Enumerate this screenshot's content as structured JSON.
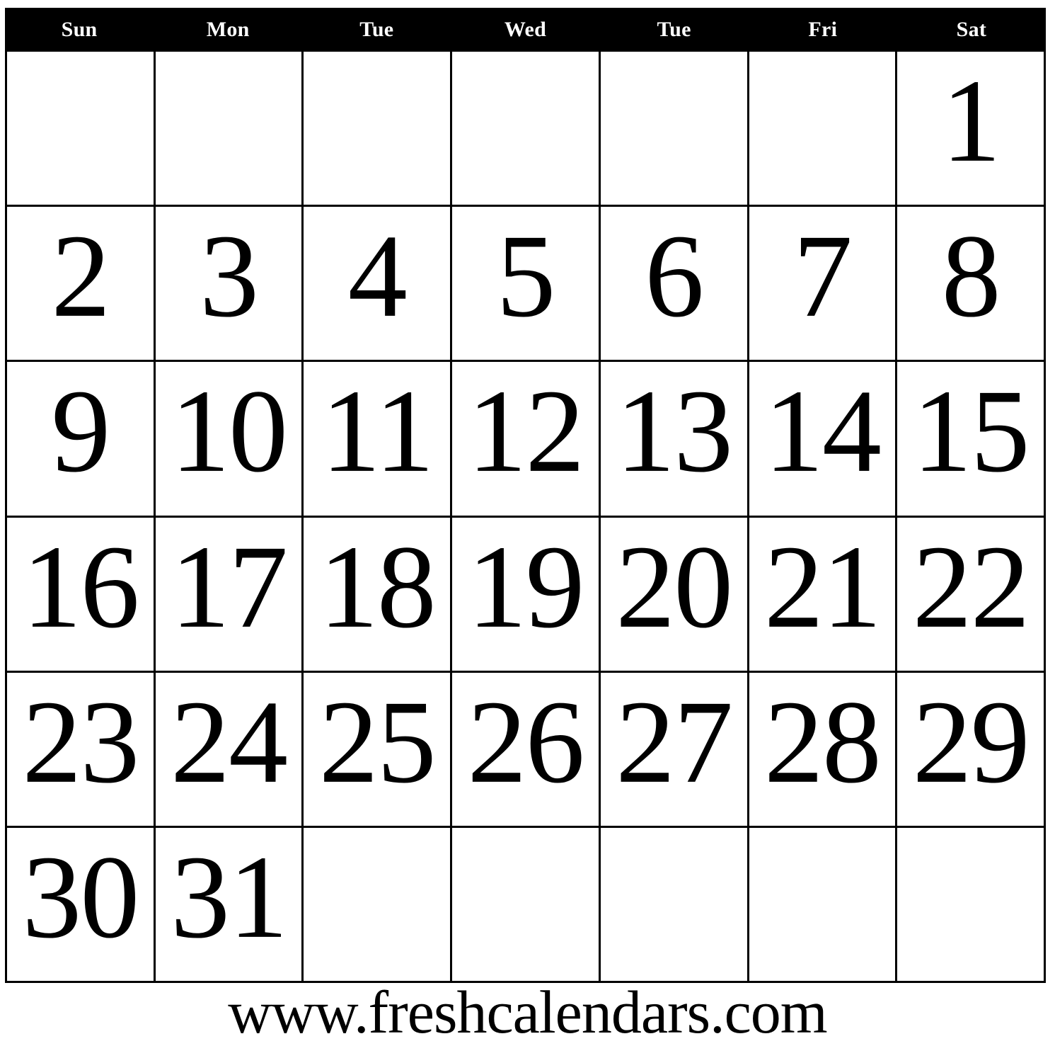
{
  "calendar": {
    "header": {
      "background_color": "#000000",
      "text_color": "#ffffff",
      "weekdays": [
        {
          "label": "Sun"
        },
        {
          "label": "Mon"
        },
        {
          "label": "Tue"
        },
        {
          "label": "Wed"
        },
        {
          "label": "Tue"
        },
        {
          "label": "Fri"
        },
        {
          "label": "Sat"
        }
      ]
    },
    "grid": {
      "columns": 7,
      "rows": 6,
      "border_color": "#000000",
      "cell_background": "#ffffff",
      "date_text_color": "#000000",
      "weeks": [
        {
          "days": [
            "",
            "",
            "",
            "",
            "",
            "",
            "1"
          ]
        },
        {
          "days": [
            "2",
            "3",
            "4",
            "5",
            "6",
            "7",
            "8"
          ]
        },
        {
          "days": [
            "9",
            "10",
            "11",
            "12",
            "13",
            "14",
            "15"
          ]
        },
        {
          "days": [
            "16",
            "17",
            "18",
            "19",
            "20",
            "21",
            "22"
          ]
        },
        {
          "days": [
            "23",
            "24",
            "25",
            "26",
            "27",
            "28",
            "29"
          ]
        },
        {
          "days": [
            "30",
            "31",
            "",
            "",
            "",
            "",
            ""
          ]
        }
      ]
    },
    "footer": {
      "website": "www.freshcalendars.com"
    }
  }
}
